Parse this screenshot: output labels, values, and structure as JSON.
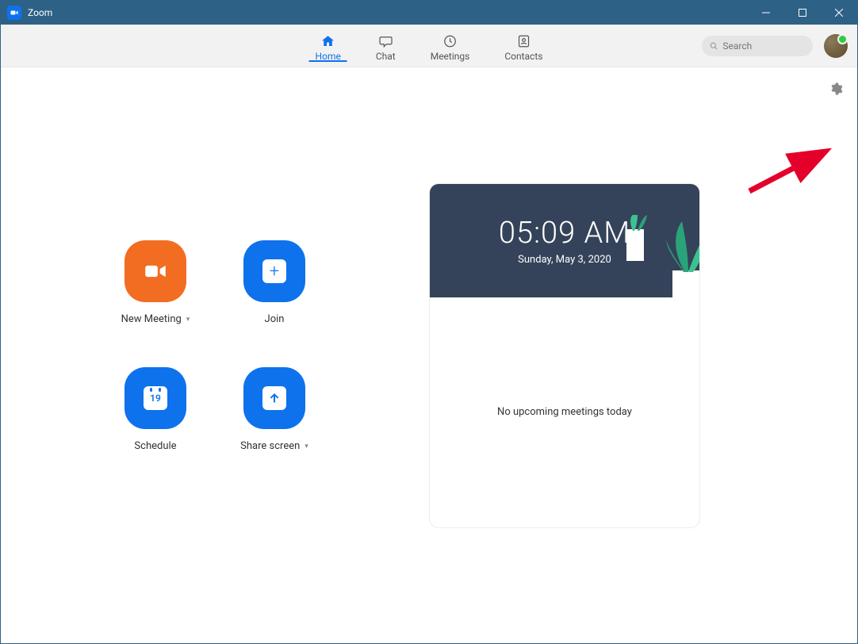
{
  "titlebar": {
    "app_name": "Zoom"
  },
  "tabs": {
    "home": "Home",
    "chat": "Chat",
    "meetings": "Meetings",
    "contacts": "Contacts"
  },
  "search": {
    "placeholder": "Search"
  },
  "actions": {
    "new_meeting": "New Meeting",
    "join": "Join",
    "schedule": "Schedule",
    "share_screen": "Share screen",
    "schedule_date": "19"
  },
  "clock": {
    "time": "05:09 AM",
    "date": "Sunday, May 3, 2020"
  },
  "meetings_status": "No upcoming meetings today"
}
